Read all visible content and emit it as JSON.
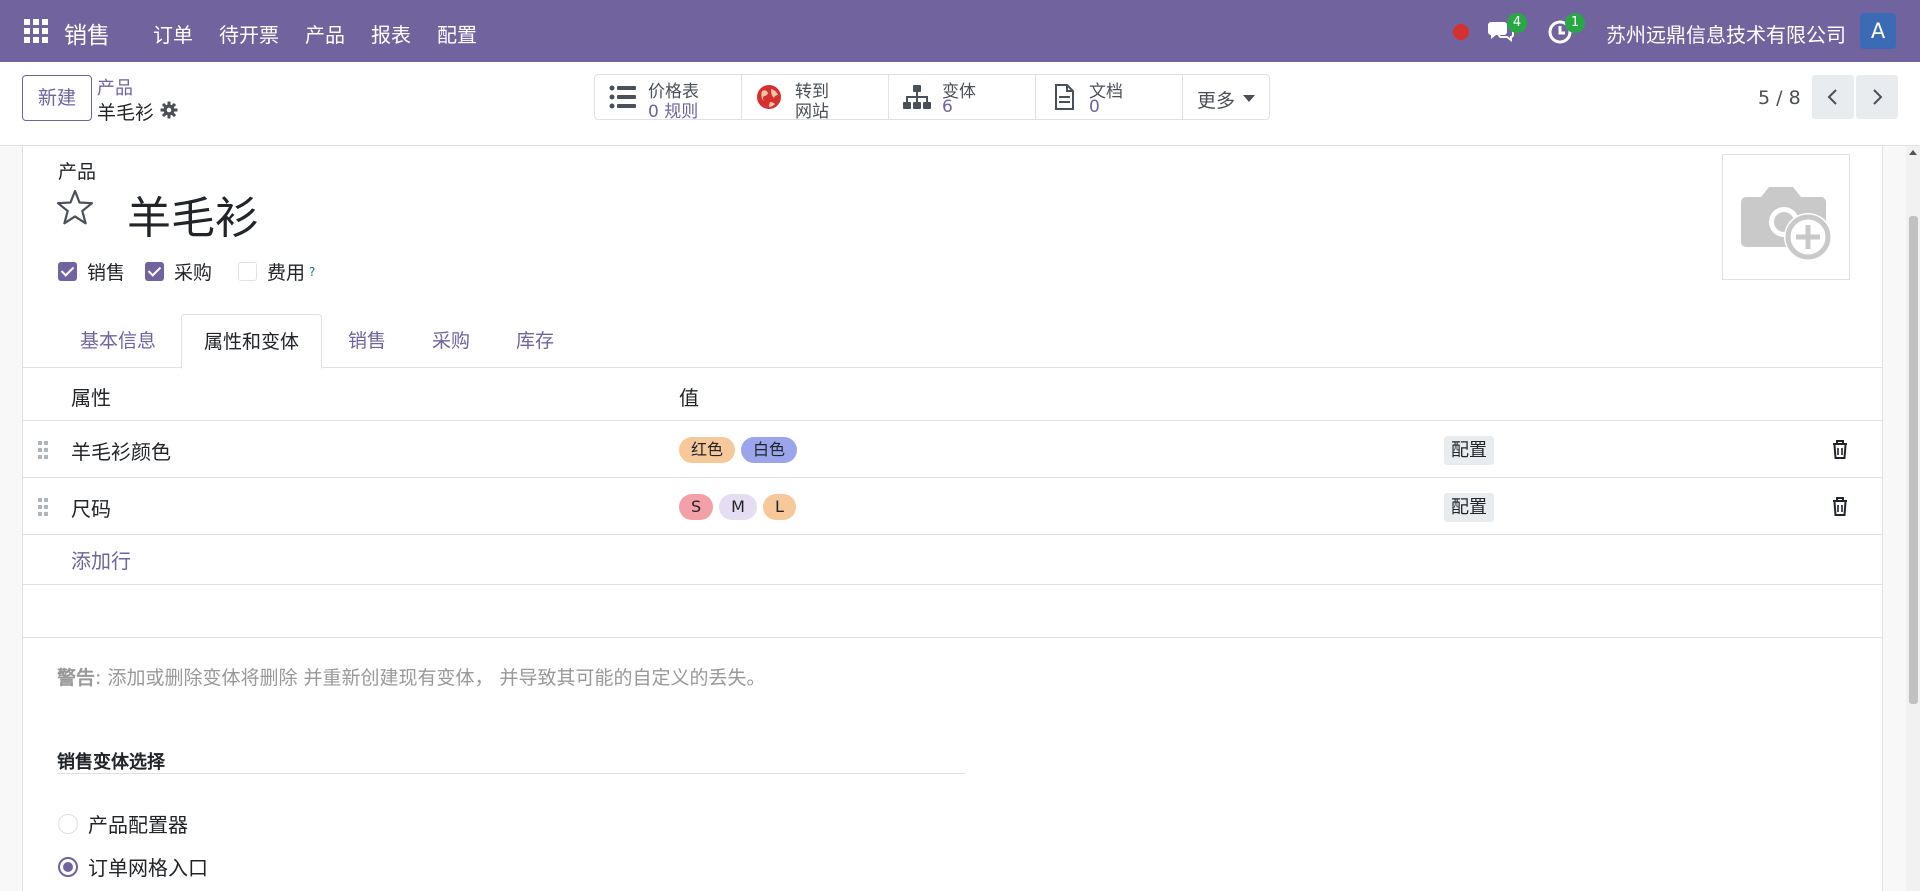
{
  "navbar": {
    "brand": "销售",
    "menu": [
      "订单",
      "待开票",
      "产品",
      "报表",
      "配置"
    ],
    "chat_count": "4",
    "activity_count": "1",
    "company": "苏州远鼎信息技术有限公司",
    "avatar_letter": "A",
    "colors": {
      "bar": "#71639e",
      "badge": "#28a745",
      "record": "#d63031",
      "avatar": "#3b6bb5"
    }
  },
  "control": {
    "new_label": "新建",
    "breadcrumb_parent": "产品",
    "breadcrumb_current": "羊毛衫",
    "smart_buttons": [
      {
        "icon": "list-icon",
        "title": "价格表",
        "value": "0 规则"
      },
      {
        "icon": "globe-icon",
        "title": "转到",
        "value": "网站"
      },
      {
        "icon": "sitemap-icon",
        "title": "变体",
        "value": "6"
      },
      {
        "icon": "file-icon",
        "title": "文档",
        "value": "0"
      }
    ],
    "more_label": "更多",
    "pager": "5 / 8"
  },
  "form": {
    "product_label": "产品",
    "product_name": "羊毛衫",
    "options": [
      {
        "label": "销售",
        "checked": true
      },
      {
        "label": "采购",
        "checked": true
      },
      {
        "label": "费用",
        "checked": false
      }
    ],
    "help_mark": "?",
    "tabs": [
      "基本信息",
      "属性和变体",
      "销售",
      "采购",
      "库存"
    ],
    "active_tab": "属性和变体",
    "table": {
      "headers": [
        "属性",
        "值"
      ],
      "rows": [
        {
          "attribute": "羊毛衫颜色",
          "values": [
            {
              "label": "红色",
              "color": "#f6c89a"
            },
            {
              "label": "白色",
              "color": "#9aa5ec"
            }
          ],
          "configure": "配置"
        },
        {
          "attribute": "尺码",
          "values": [
            {
              "label": "S",
              "color": "#f4a0a8"
            },
            {
              "label": "M",
              "color": "#e6ddf3"
            },
            {
              "label": "L",
              "color": "#f6c89a"
            }
          ],
          "configure": "配置"
        }
      ],
      "add_line": "添加行"
    },
    "warning_label": "警告",
    "warning_text": ": 添加或删除变体将删除 并重新创建现有变体， 并导致其可能的自定义的丢失。",
    "sales_variant_section": "销售变体选择",
    "variant_modes": [
      {
        "label": "产品配置器",
        "selected": false
      },
      {
        "label": "订单网格入口",
        "selected": true
      }
    ]
  }
}
